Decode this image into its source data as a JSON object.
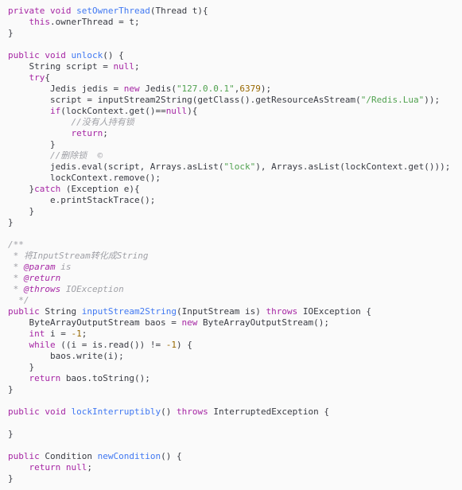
{
  "colors": {
    "background": "#fafafa",
    "keyword": "#a626a4",
    "function": "#4078f2",
    "string": "#50a14f",
    "number": "#986801",
    "comment": "#a0a1a7",
    "text": "#383a42"
  },
  "code": {
    "lines": [
      [
        [
          "k",
          "private"
        ],
        [
          "p",
          " "
        ],
        [
          "k",
          "void"
        ],
        [
          "p",
          " "
        ],
        [
          "f",
          "setOwnerThread"
        ],
        [
          "p",
          "(Thread t){"
        ]
      ],
      [
        [
          "p",
          "    "
        ],
        [
          "k",
          "this"
        ],
        [
          "p",
          ".ownerThread = t;"
        ]
      ],
      [
        [
          "p",
          "}"
        ]
      ],
      [],
      [
        [
          "k",
          "public"
        ],
        [
          "p",
          " "
        ],
        [
          "k",
          "void"
        ],
        [
          "p",
          " "
        ],
        [
          "f",
          "unlock"
        ],
        [
          "p",
          "() {"
        ]
      ],
      [
        [
          "p",
          "    String script = "
        ],
        [
          "k",
          "null"
        ],
        [
          "p",
          ";"
        ]
      ],
      [
        [
          "p",
          "    "
        ],
        [
          "k",
          "try"
        ],
        [
          "p",
          "{"
        ]
      ],
      [
        [
          "p",
          "        Jedis jedis = "
        ],
        [
          "k",
          "new"
        ],
        [
          "p",
          " Jedis("
        ],
        [
          "s",
          "\"127.0.0.1\""
        ],
        [
          "p",
          ","
        ],
        [
          "n",
          "6379"
        ],
        [
          "p",
          ");"
        ]
      ],
      [
        [
          "p",
          "        script = inputStream2String(getClass().getResourceAsStream("
        ],
        [
          "s",
          "\"/Redis.Lua\""
        ],
        [
          "p",
          "));"
        ]
      ],
      [
        [
          "p",
          "        "
        ],
        [
          "k",
          "if"
        ],
        [
          "p",
          "(lockContext.get()=="
        ],
        [
          "k",
          "null"
        ],
        [
          "p",
          "){"
        ]
      ],
      [
        [
          "p",
          "            "
        ],
        [
          "c",
          "//没有人持有锁"
        ]
      ],
      [
        [
          "p",
          "            "
        ],
        [
          "k",
          "return"
        ],
        [
          "p",
          ";"
        ]
      ],
      [
        [
          "p",
          "        }"
        ]
      ],
      [
        [
          "p",
          "        "
        ],
        [
          "c",
          "//删除锁  ©"
        ]
      ],
      [
        [
          "p",
          "        jedis.eval(script, Arrays.asList("
        ],
        [
          "s",
          "\"lock\""
        ],
        [
          "p",
          "), Arrays.asList(lockContext.get()));"
        ]
      ],
      [
        [
          "p",
          "        lockContext.remove();"
        ]
      ],
      [
        [
          "p",
          "    }"
        ],
        [
          "k",
          "catch"
        ],
        [
          "p",
          " (Exception e){"
        ]
      ],
      [
        [
          "p",
          "        e.printStackTrace();"
        ]
      ],
      [
        [
          "p",
          "    }"
        ]
      ],
      [
        [
          "p",
          "}"
        ]
      ],
      [],
      [
        [
          "c",
          "/**"
        ]
      ],
      [
        [
          "c",
          " * 将InputStream转化成String"
        ]
      ],
      [
        [
          "c",
          " * "
        ],
        [
          "t",
          "@param"
        ],
        [
          "c",
          " is"
        ]
      ],
      [
        [
          "c",
          " * "
        ],
        [
          "t",
          "@return"
        ]
      ],
      [
        [
          "c",
          " * "
        ],
        [
          "t",
          "@throws"
        ],
        [
          "c",
          " IOException"
        ]
      ],
      [
        [
          "c",
          "  */"
        ]
      ],
      [
        [
          "k",
          "public"
        ],
        [
          "p",
          " String "
        ],
        [
          "f",
          "inputStream2String"
        ],
        [
          "p",
          "(InputStream is) "
        ],
        [
          "k",
          "throws"
        ],
        [
          "p",
          " IOException {"
        ]
      ],
      [
        [
          "p",
          "    ByteArrayOutputStream baos = "
        ],
        [
          "k",
          "new"
        ],
        [
          "p",
          " ByteArrayOutputStream();"
        ]
      ],
      [
        [
          "p",
          "    "
        ],
        [
          "k",
          "int"
        ],
        [
          "p",
          " i = "
        ],
        [
          "n",
          "-1"
        ],
        [
          "p",
          ";"
        ]
      ],
      [
        [
          "p",
          "    "
        ],
        [
          "k",
          "while"
        ],
        [
          "p",
          " ((i = is.read()) != "
        ],
        [
          "n",
          "-1"
        ],
        [
          "p",
          ") {"
        ]
      ],
      [
        [
          "p",
          "        baos.write(i);"
        ]
      ],
      [
        [
          "p",
          "    }"
        ]
      ],
      [
        [
          "p",
          "    "
        ],
        [
          "k",
          "return"
        ],
        [
          "p",
          " baos.toString();"
        ]
      ],
      [
        [
          "p",
          "}"
        ]
      ],
      [],
      [
        [
          "k",
          "public"
        ],
        [
          "p",
          " "
        ],
        [
          "k",
          "void"
        ],
        [
          "p",
          " "
        ],
        [
          "f",
          "lockInterruptibly"
        ],
        [
          "p",
          "() "
        ],
        [
          "k",
          "throws"
        ],
        [
          "p",
          " InterruptedException {"
        ]
      ],
      [],
      [
        [
          "p",
          "}"
        ]
      ],
      [],
      [
        [
          "k",
          "public"
        ],
        [
          "p",
          " Condition "
        ],
        [
          "f",
          "newCondition"
        ],
        [
          "p",
          "() {"
        ]
      ],
      [
        [
          "p",
          "    "
        ],
        [
          "k",
          "return"
        ],
        [
          "p",
          " "
        ],
        [
          "k",
          "null"
        ],
        [
          "p",
          ";"
        ]
      ],
      [
        [
          "p",
          "}"
        ]
      ]
    ]
  }
}
